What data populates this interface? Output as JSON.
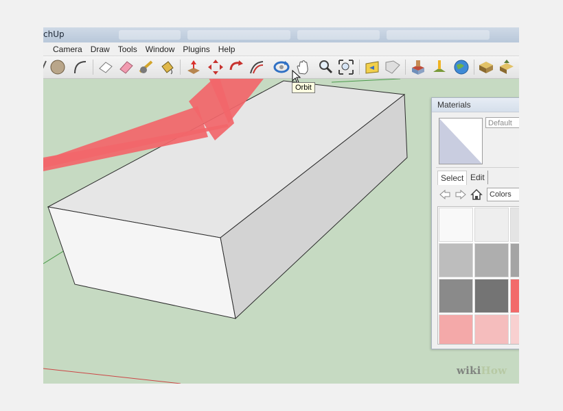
{
  "window": {
    "title": "chUp"
  },
  "menu": {
    "items": [
      "Camera",
      "Draw",
      "Tools",
      "Window",
      "Plugins",
      "Help"
    ]
  },
  "toolbar": {
    "tooltip": "Orbit",
    "highlighted_tool_icon": "orbit-icon"
  },
  "materials": {
    "title": "Materials",
    "material_name": "Default",
    "tabs": [
      "Select",
      "Edit"
    ],
    "library": "Colors",
    "swatches": [
      [
        "#f9f9f9",
        "#eeeeee",
        "#e4e4e4"
      ],
      [
        "#bdbdbd",
        "#aeaeae",
        "#a4a4a4"
      ],
      [
        "#8a8a8a",
        "#747474",
        "#f26a6a"
      ],
      [
        "#f4a9a9",
        "#f5bdbd",
        "#f8d0d0"
      ]
    ]
  },
  "watermark": {
    "wiki": "wiki",
    "how": "How"
  },
  "colors": {
    "ground": "#c6dac2",
    "arrow": "#f2666a",
    "box_top": "#e7e7e7",
    "box_front": "#f6f6f6",
    "box_side": "#d4d4d4"
  }
}
